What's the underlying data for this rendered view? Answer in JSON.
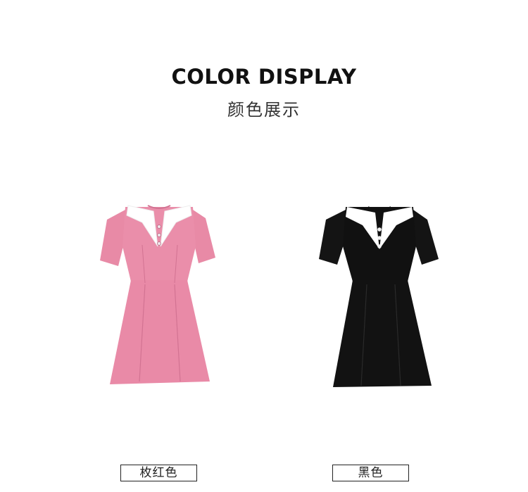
{
  "header": {
    "title_en": "COLOR DISPLAY",
    "title_cn": "颜色展示"
  },
  "products": [
    {
      "color_name": "枚红色",
      "dress_color": "#e88aa6",
      "collar_color": "#ffffff"
    },
    {
      "color_name": "黑色",
      "dress_color": "#141414",
      "collar_color": "#ffffff"
    }
  ]
}
